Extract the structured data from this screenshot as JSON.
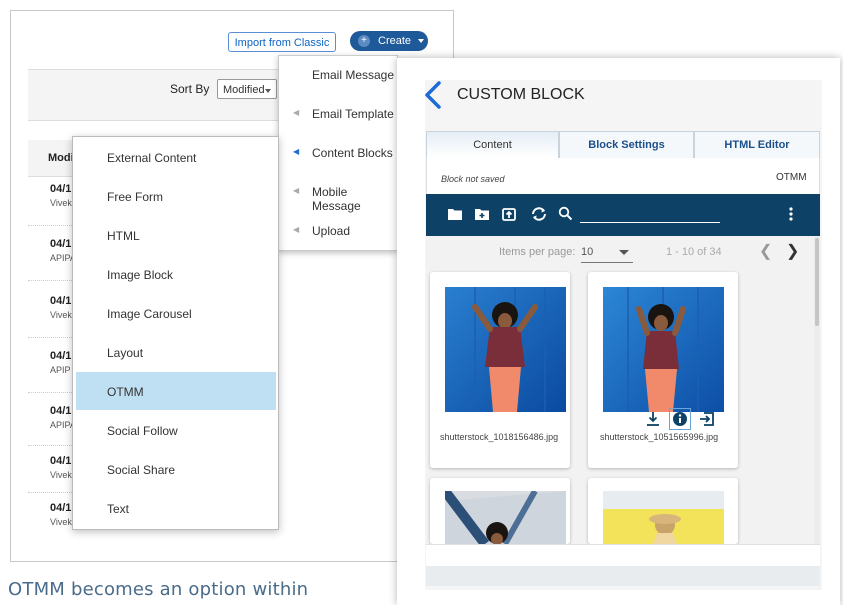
{
  "toolbar": {
    "import_label": "Import from Classic",
    "create_label": "Create",
    "create_plus": "+"
  },
  "sort": {
    "label": "Sort By",
    "selected": "Modified"
  },
  "list": {
    "column_header": "Modi",
    "rows": [
      {
        "date": "04/1",
        "user": "Vivek"
      },
      {
        "date": "04/1",
        "user": "APIPA"
      },
      {
        "date": "04/1",
        "user": "Vivek"
      },
      {
        "date": "04/1",
        "user": "APIP"
      },
      {
        "date": "04/1",
        "user": "APIPA"
      },
      {
        "date": "04/1",
        "user": "Vivek"
      },
      {
        "date": "04/1",
        "user": "Vivek"
      }
    ]
  },
  "create_menu": {
    "items": [
      {
        "label": "Email Message",
        "submenu": false
      },
      {
        "label": "Email Template",
        "submenu": true
      },
      {
        "label": "Content Blocks",
        "submenu": true,
        "active": true
      },
      {
        "label": "Mobile Message",
        "submenu": true
      },
      {
        "label": "Upload",
        "submenu": true
      }
    ]
  },
  "content_blocks_menu": {
    "items": [
      {
        "label": "External Content"
      },
      {
        "label": "Free Form"
      },
      {
        "label": "HTML"
      },
      {
        "label": "Image Block"
      },
      {
        "label": "Image Carousel"
      },
      {
        "label": "Layout"
      },
      {
        "label": "OTMM",
        "selected": true
      },
      {
        "label": "Social Follow"
      },
      {
        "label": "Social Share"
      },
      {
        "label": "Text"
      }
    ]
  },
  "caption": "OTMM becomes an option within",
  "dialog": {
    "title": "CUSTOM BLOCK",
    "tabs": [
      {
        "label": "Content",
        "active": true
      },
      {
        "label": "Block Settings",
        "active": false
      },
      {
        "label": "HTML Editor",
        "active": false
      }
    ],
    "status": "Block not saved",
    "source": "OTMM",
    "toolbar_icons": [
      "folder-icon",
      "new-folder-icon",
      "upload-icon",
      "refresh-icon",
      "search-icon",
      "more-vert-icon"
    ],
    "pager": {
      "items_per_page_label": "Items per page:",
      "items_per_page": "10",
      "range": "1 - 10 of 34"
    },
    "assets": [
      {
        "name": "shutterstock_1018156486.jpg"
      },
      {
        "name": "shutterstock_1051565996.jpg"
      }
    ],
    "colors": {
      "toolbar": "#0d4266",
      "accent": "#1e6bd6",
      "selected": "#bfe0f3"
    }
  }
}
